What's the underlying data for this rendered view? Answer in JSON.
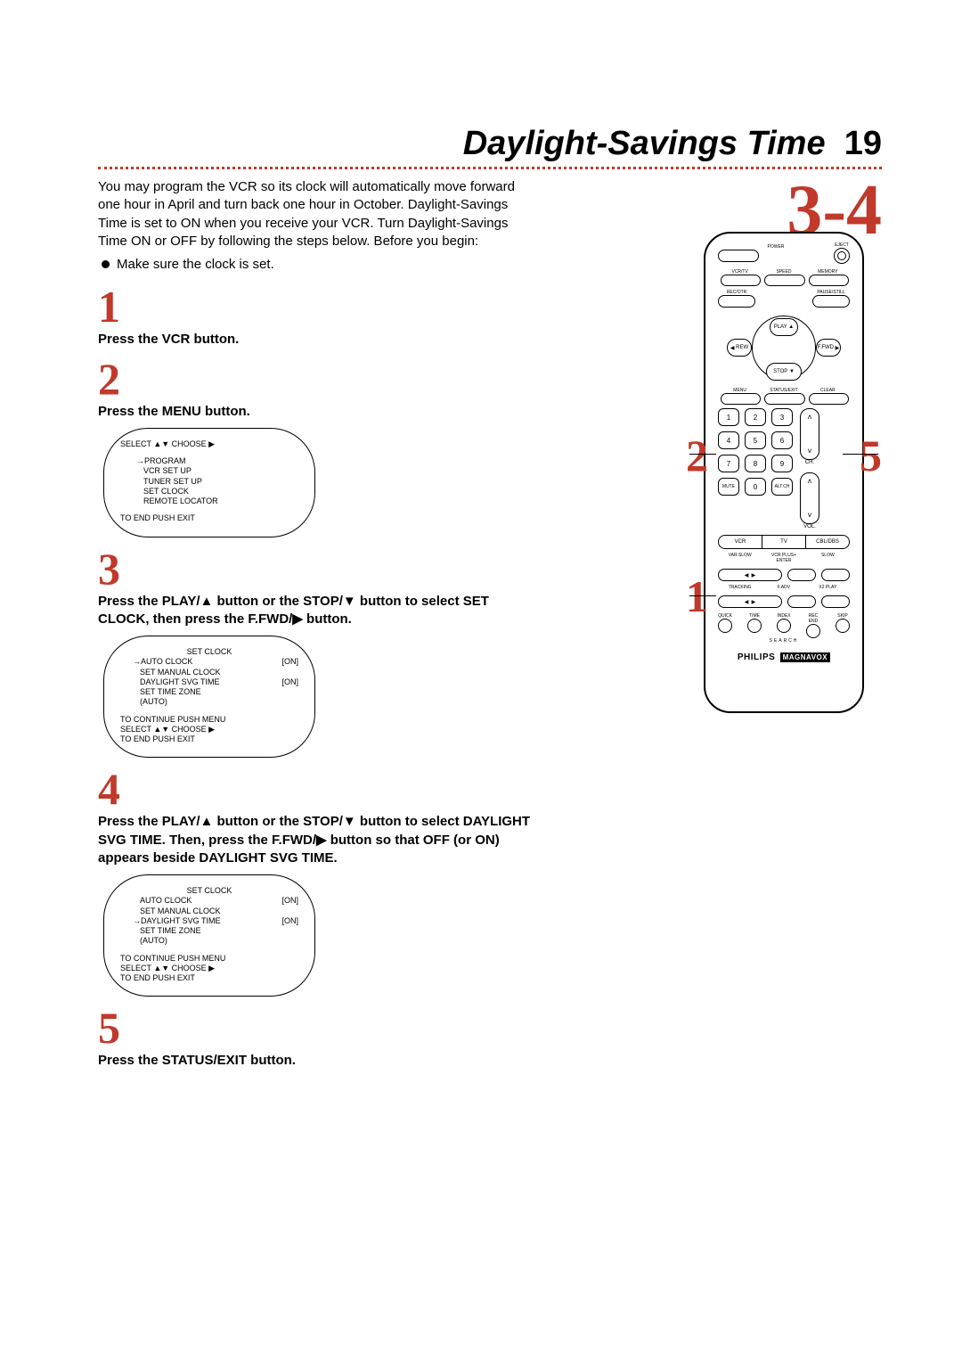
{
  "page": {
    "title": "Daylight-Savings Time",
    "number": "19",
    "section": "3-4"
  },
  "intro": "You may program the VCR so its clock will automatically move forward one hour in April and turn back one hour in October. Daylight-Savings Time is set to ON when you receive your VCR. Turn Daylight-Savings Time ON or OFF by following the steps below. Before you begin:",
  "bullet": "Make sure the clock is set.",
  "steps": {
    "s1": {
      "num": "1",
      "text": "Press the VCR button."
    },
    "s2": {
      "num": "2",
      "text": "Press the MENU button."
    },
    "s3": {
      "num": "3",
      "text": "Press the PLAY/▲ button or the STOP/▼ button to select SET CLOCK, then press the F.FWD/▶ button."
    },
    "s4": {
      "num": "4",
      "text": "Press the PLAY/▲ button or the STOP/▼ button to select DAYLIGHT SVG TIME. Then, press the F.FWD/▶ button so that OFF (or ON) appears beside DAYLIGHT SVG TIME."
    },
    "s5": {
      "num": "5",
      "text": "Press the STATUS/EXIT button."
    }
  },
  "osd1": {
    "header": "SELECT ▲▼ CHOOSE ▶",
    "lines": [
      "→PROGRAM",
      "VCR SET UP",
      "TUNER SET UP",
      "SET CLOCK",
      "REMOTE LOCATOR"
    ],
    "footer": "TO END PUSH EXIT"
  },
  "osd2": {
    "title": "SET CLOCK",
    "rows": [
      {
        "label": "→AUTO CLOCK",
        "val": "[ON]"
      },
      {
        "label": "SET MANUAL CLOCK",
        "val": ""
      },
      {
        "label": "DAYLIGHT SVG TIME",
        "val": "[ON]"
      },
      {
        "label": "SET TIME ZONE",
        "val": ""
      },
      {
        "label": "(AUTO)",
        "val": ""
      }
    ],
    "foot1": "TO CONTINUE PUSH MENU",
    "foot2": "SELECT ▲▼ CHOOSE ▶",
    "foot3": "TO END PUSH EXIT"
  },
  "osd3": {
    "title": "SET CLOCK",
    "rows": [
      {
        "label": "AUTO CLOCK",
        "val": "[ON]"
      },
      {
        "label": "SET MANUAL CLOCK",
        "val": ""
      },
      {
        "label": "→DAYLIGHT SVG TIME",
        "val": "[ON]"
      },
      {
        "label": "SET TIME ZONE",
        "val": ""
      },
      {
        "label": "(AUTO)",
        "val": ""
      }
    ],
    "foot1": "TO CONTINUE PUSH MENU",
    "foot2": "SELECT ▲▼ CHOOSE ▶",
    "foot3": "TO END PUSH EXIT"
  },
  "callouts": {
    "c1": "1",
    "c2": "2",
    "c5": "5"
  },
  "remote": {
    "power": "POWER",
    "eject": "EJECT",
    "vcrtv": "VCR/TV",
    "speed": "SPEED",
    "memory": "MEMORY",
    "recotr": "REC/OTR",
    "pausestill": "PAUSE/STILL",
    "play": "PLAY",
    "rew": "REW",
    "ffwd": "F.FWD",
    "stop": "STOP",
    "menu": "MENU",
    "statusexit": "STATUS/EXIT",
    "clear": "CLEAR",
    "keys": {
      "k1": "1",
      "k2": "2",
      "k3": "3",
      "k4": "4",
      "k5": "5",
      "k6": "6",
      "k7": "7",
      "k8": "8",
      "k9": "9",
      "mute": "MUTE",
      "k0": "0",
      "altch": "ALT.CH"
    },
    "ch": "CH.",
    "vol": "VOL.",
    "seg": {
      "vcr": "VCR",
      "tv": "TV",
      "cbl": "CBL/DBS"
    },
    "varslow": "VAR.SLOW",
    "vcrplus": "VCR PLUS+\nENTER",
    "slow": "SLOW",
    "tracking": "TRACKING",
    "fadv": "F.ADV",
    "x2play": "X2 PLAY",
    "circles": {
      "quick": "QUICK",
      "time": "TIME",
      "index": "INDEX",
      "recend": "REC END",
      "skip": "SKIP"
    },
    "search": "SEARCH",
    "brand": "PHILIPS",
    "brand2": "MAGNAVOX"
  }
}
